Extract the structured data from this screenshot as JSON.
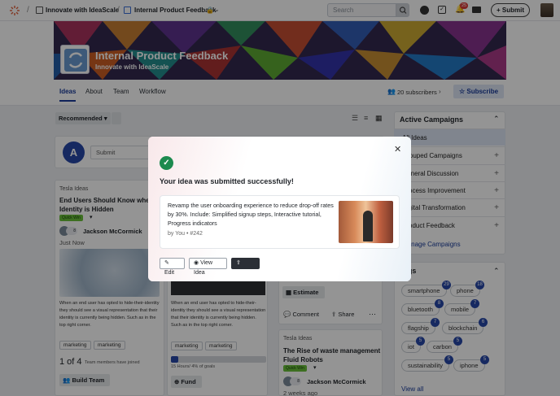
{
  "header": {
    "breadcrumb_community": "Innovate with IdeaScale",
    "breadcrumb_campaign": "Internal Product Feedback",
    "search_placeholder": "Search",
    "notification_count": "25",
    "submit_label": "+ Submit"
  },
  "banner": {
    "title": "Internal Product Feedback",
    "subtitle": "Innovate with IdeaScale"
  },
  "subnav": {
    "tabs": [
      "Ideas",
      "About",
      "Team",
      "Workflow"
    ],
    "subscribers": "20 subscribers",
    "subscribe_label": "Subscribe"
  },
  "toolbar": {
    "sort_label": "Recommended"
  },
  "submit_box": {
    "avatar_letter": "A",
    "placeholder": "Submit"
  },
  "left_card": {
    "campaign": "Tesla Ideas",
    "title": "End Users Should Know when Identity is Hidden",
    "status": "Quick Win",
    "author": "Jackson McCormick",
    "time": "Just Now",
    "votes": "8",
    "body": "When an end user has opted to hide-their-identity they should see a visual representation that their identity is currently being hidden. Such as in the top right corner.",
    "tags": [
      "marketing",
      "marketing"
    ],
    "team_count": "1 of 4",
    "team_text": "Team members have joined",
    "build_label": "Build Team"
  },
  "middle_card": {
    "body": "When an end user has opted to hide-their-identity they should see a visual representation that their identity is currently being hidden. Such as in the top right corner.",
    "tags": [
      "marketing",
      "marketing"
    ],
    "progress_text": "15 Hours/ 4% of goals",
    "progress": 0.04,
    "fund_label": "Fund"
  },
  "right_card_top": {
    "estimate_label": "Estimate",
    "comment_label": "Comment",
    "share_label": "Share"
  },
  "right_card_bottom": {
    "campaign": "Tesla Ideas",
    "title": "The Rise of waste management Fluid Robots",
    "status": "Quick Win",
    "author": "Jackson McCormick",
    "time": "2 weeks ago",
    "votes": "8"
  },
  "sidebar": {
    "campaigns_title": "Active Campaigns",
    "campaigns": [
      "All Ideas",
      "Grouped Campaigns",
      "General Discussion",
      "Process Improvement",
      "Digital Transformation",
      "Product Feedback"
    ],
    "manage_label": "Manage Campaigns",
    "tags_title": "Tags",
    "tags": [
      {
        "name": "smartphone",
        "count": "29"
      },
      {
        "name": "phone",
        "count": "18"
      },
      {
        "name": "bluetooth",
        "count": "8"
      },
      {
        "name": "mobile",
        "count": "7"
      },
      {
        "name": "flagship",
        "count": "7"
      },
      {
        "name": "blockchain",
        "count": "6"
      },
      {
        "name": "iot",
        "count": "5"
      },
      {
        "name": "carbon",
        "count": "5"
      },
      {
        "name": "sustainability",
        "count": "5"
      },
      {
        "name": "iphone",
        "count": "5"
      }
    ],
    "view_all_label": "View all"
  },
  "modal": {
    "success_text": "Your idea was submitted successfully!",
    "idea_text": "Revamp the user onboarding experience to reduce drop-off rates by 30%. Include: Simplified signup steps, Interactive tutorial, Progress indicators",
    "meta": "by You • #242",
    "edit_label": "Edit",
    "view_label": "View Idea",
    "share_label": "Share"
  },
  "colors": {
    "accent": "#2747a8",
    "success": "#1c8a4e",
    "gray_bg": "#eef0f3",
    "status_green": "#6abf3a"
  }
}
